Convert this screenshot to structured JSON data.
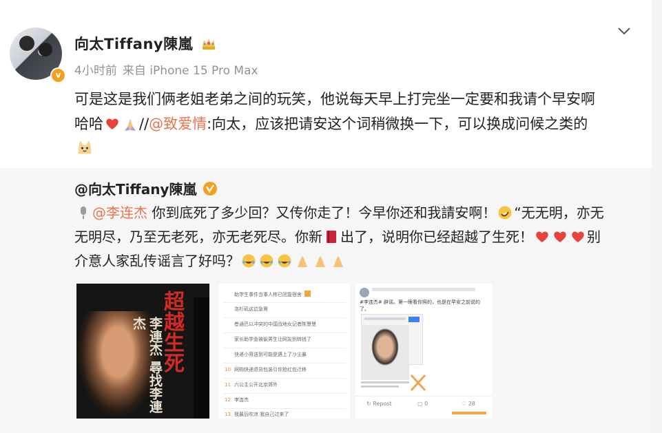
{
  "post": {
    "author": "向太Tiffany陳嵐",
    "time": "4小时前",
    "source": "来自 iPhone 15 Pro Max",
    "line1": "可是这是我们俩老姐老弟之间的玩笑，他说每天早上打完坐一定要和我请个早安啊",
    "line2_a": "哈哈",
    "line2_b": "//",
    "mention": "@致爱情",
    "line2_c": ":向太，应该把请安这个词稍微换一下，可以换成问候之类的"
  },
  "repost": {
    "author": "@向太Tiffany陳嵐",
    "mention": "@李连杰",
    "line1_a": " 你到底死了多少回？又传你走了！今早你还和我請安啊！",
    "line1_b": "“无无明，亦无",
    "line2": "无明尽，乃至无老死，亦无老死尽。你新",
    "line2_b": "出了，说明你已经超越了生死！",
    "line2_c": "别",
    "line3": "介意人家乱传谣言了好吗？",
    "images": {
      "book": {
        "title": "超越生死",
        "subtitle": "李連杰 尋找李連杰"
      },
      "list_rows": [
        {
          "num": "",
          "text": "助学生事件当事人称已回复宿舍"
        },
        {
          "num": "",
          "text": "洛杉矶这边急需"
        },
        {
          "num": "",
          "text": "叁通巴以冲突的中国战地女记者陈慧慧"
        },
        {
          "num": "",
          "text": "家长助学金被偷男生让网友别转钱了"
        },
        {
          "num": "",
          "text": "快递小哥送到可能是遇上了沙尘暴"
        },
        {
          "num": "10",
          "text": "网购快递退货包装引你抢红包迁移"
        },
        {
          "num": "11",
          "text": "六公主公开北京郊外"
        },
        {
          "num": "12",
          "text": "李连杰"
        },
        {
          "num": "13",
          "text": "我最后吹凉 我自己过来了"
        }
      ],
      "screenshot": {
        "caption": "#李连杰# 辟谣。第一眼看你照的，也是在早安之前说的了。",
        "repost_label": "Repost",
        "comment_label": "0",
        "like_label": "28"
      }
    }
  },
  "icons": {
    "chevron": "chevron-down-icon",
    "verified": "verified-badge-icon",
    "crown": "crown-icon",
    "heart": "red-heart-icon",
    "pray": "folded-hands-icon",
    "cat": "cat-face-icon",
    "mic": "microphone-icon",
    "rofl": "rofl-face-icon",
    "book": "red-book-icon",
    "joy": "tears-of-joy-icon"
  },
  "colors": {
    "mention": "#eb7350",
    "verified": "#f59f1c",
    "heart": "#e8433b"
  }
}
